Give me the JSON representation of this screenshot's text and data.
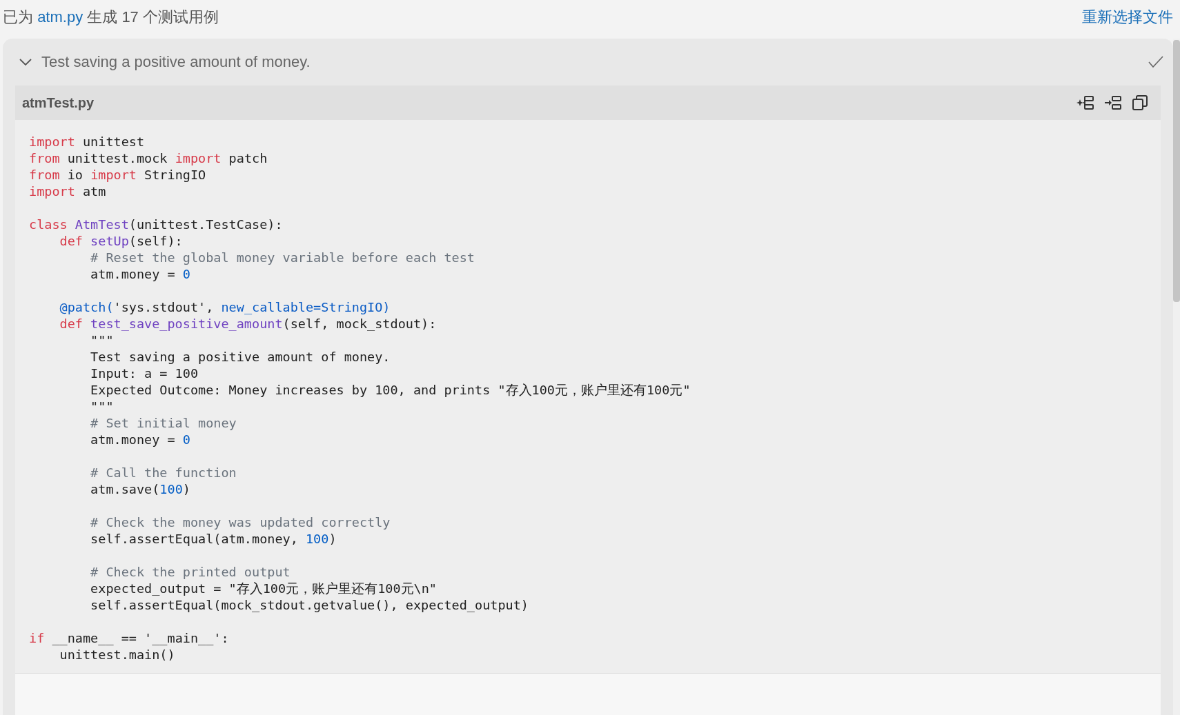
{
  "header": {
    "parts": [
      {
        "kind": "text",
        "text": "已为 "
      },
      {
        "kind": "link",
        "text": "atm.py"
      },
      {
        "kind": "text",
        "text": " 生成 17 个测试用例"
      }
    ],
    "action": "重新选择文件"
  },
  "test_case": {
    "title": "Test saving a positive amount of money.",
    "expanded": true,
    "passed": true,
    "file": {
      "name": "atmTest.py",
      "blocks": [
        {
          "lines": [
            [
              {
                "kind": "kw",
                "text": "import"
              },
              {
                "kind": "t",
                "text": " unittest"
              }
            ],
            [
              {
                "kind": "kw",
                "text": "from"
              },
              {
                "kind": "t",
                "text": " unittest.mock "
              },
              {
                "kind": "kw",
                "text": "import"
              },
              {
                "kind": "t",
                "text": " patch"
              }
            ],
            [
              {
                "kind": "kw",
                "text": "from"
              },
              {
                "kind": "t",
                "text": " io "
              },
              {
                "kind": "kw",
                "text": "import"
              },
              {
                "kind": "t",
                "text": " StringIO"
              }
            ],
            [
              {
                "kind": "kw",
                "text": "import"
              },
              {
                "kind": "t",
                "text": " atm"
              }
            ]
          ]
        },
        {
          "lines": [
            [
              {
                "kind": "kw",
                "text": "class"
              },
              {
                "kind": "fn",
                "text": " AtmTest"
              },
              {
                "kind": "t",
                "text": "(unittest.TestCase):"
              }
            ],
            [
              {
                "kind": "kw",
                "text": "    def"
              },
              {
                "kind": "fn",
                "text": " setUp"
              },
              {
                "kind": "t",
                "text": "(self):"
              }
            ],
            [
              {
                "kind": "cm",
                "text": "        # Reset the global money variable before each test"
              }
            ],
            [
              {
                "kind": "t",
                "text": "        atm.money = "
              },
              {
                "kind": "num",
                "text": "0"
              }
            ]
          ]
        },
        {
          "lines": [
            [
              {
                "kind": "dec",
                "text": "    @patch("
              },
              {
                "kind": "t",
                "text": "'sys.stdout', "
              },
              {
                "kind": "dec",
                "text": "new_callable=StringIO)"
              }
            ],
            [
              {
                "kind": "kw",
                "text": "    def"
              },
              {
                "kind": "fn",
                "text": " test_save_positive_amount"
              },
              {
                "kind": "t",
                "text": "(self, mock_stdout):"
              }
            ],
            [
              {
                "kind": "t",
                "text": "        \"\"\""
              }
            ],
            [
              {
                "kind": "t",
                "text": "        Test saving a positive amount of money."
              }
            ],
            [
              {
                "kind": "t",
                "text": "        Input: a = 100"
              }
            ],
            [
              {
                "kind": "t",
                "text": "        Expected Outcome: Money increases by 100, and prints \"存入100元，账户里还有100元\""
              }
            ],
            [
              {
                "kind": "t",
                "text": "        \"\"\""
              }
            ],
            [
              {
                "kind": "cm",
                "text": "        # Set initial money"
              }
            ],
            [
              {
                "kind": "t",
                "text": "        atm.money = "
              },
              {
                "kind": "num",
                "text": "0"
              }
            ]
          ]
        },
        {
          "lines": [
            [
              {
                "kind": "cm",
                "text": "        # Call the function"
              }
            ],
            [
              {
                "kind": "t",
                "text": "        atm.save("
              },
              {
                "kind": "num",
                "text": "100"
              },
              {
                "kind": "t",
                "text": ")"
              }
            ]
          ]
        },
        {
          "lines": [
            [
              {
                "kind": "cm",
                "text": "        # Check the money was updated correctly"
              }
            ],
            [
              {
                "kind": "t",
                "text": "        self.assertEqual(atm.money, "
              },
              {
                "kind": "num",
                "text": "100"
              },
              {
                "kind": "t",
                "text": ")"
              }
            ]
          ]
        },
        {
          "lines": [
            [
              {
                "kind": "cm",
                "text": "        # Check the printed output"
              }
            ],
            [
              {
                "kind": "t",
                "text": "        expected_output = \"存入100元，账户里还有100元\\n\""
              }
            ],
            [
              {
                "kind": "t",
                "text": "        self.assertEqual(mock_stdout.getvalue(), expected_output)"
              }
            ]
          ]
        },
        {
          "lines": [
            [
              {
                "kind": "kw",
                "text": "if"
              },
              {
                "kind": "t",
                "text": " __name__ == '__main__':"
              }
            ],
            [
              {
                "kind": "t",
                "text": "    unittest.main()"
              }
            ]
          ]
        }
      ]
    }
  }
}
